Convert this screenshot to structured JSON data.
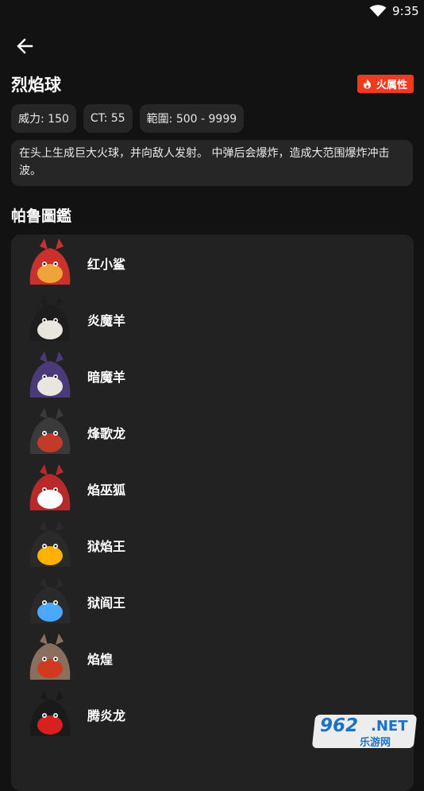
{
  "status_bar": {
    "time": "9:35"
  },
  "header": {
    "back_icon": "arrow-left-icon"
  },
  "skill": {
    "name": "烈焰球",
    "element_badge": {
      "label": "火属性",
      "icon": "flame-icon",
      "color": "#ee3b1f"
    },
    "stats": [
      {
        "label": "威力: 150"
      },
      {
        "label": "CT: 55"
      },
      {
        "label": "範圍: 500 - 9999"
      }
    ],
    "description": "在头上生成巨大火球，并向敌人发射。 中弹后会爆炸，造成大范围爆炸冲击波。"
  },
  "paldeck": {
    "title": "帕鲁圖鑑",
    "items": [
      {
        "name": "红小鲨",
        "avatar_colors": [
          "#c8312c",
          "#f0a33a"
        ]
      },
      {
        "name": "炎魔羊",
        "avatar_colors": [
          "#1d1d1d",
          "#e9e6de"
        ]
      },
      {
        "name": "暗魔羊",
        "avatar_colors": [
          "#4b3a78",
          "#e9e6de"
        ]
      },
      {
        "name": "烽歌龙",
        "avatar_colors": [
          "#3a3a3a",
          "#c23a2a"
        ]
      },
      {
        "name": "焰巫狐",
        "avatar_colors": [
          "#b82a2a",
          "#ffffff"
        ]
      },
      {
        "name": "狱焰王",
        "avatar_colors": [
          "#2a2a2a",
          "#ffb000"
        ]
      },
      {
        "name": "狱阎王",
        "avatar_colors": [
          "#2a2a2a",
          "#4aa8ff"
        ]
      },
      {
        "name": "焰煌",
        "avatar_colors": [
          "#8a6e5e",
          "#d23a1f"
        ]
      },
      {
        "name": "腾炎龙",
        "avatar_colors": [
          "#1a1a1a",
          "#d8201f"
        ]
      }
    ]
  },
  "watermark": {
    "number": "962",
    "suffix": ".NET",
    "subtitle": "乐游网"
  }
}
